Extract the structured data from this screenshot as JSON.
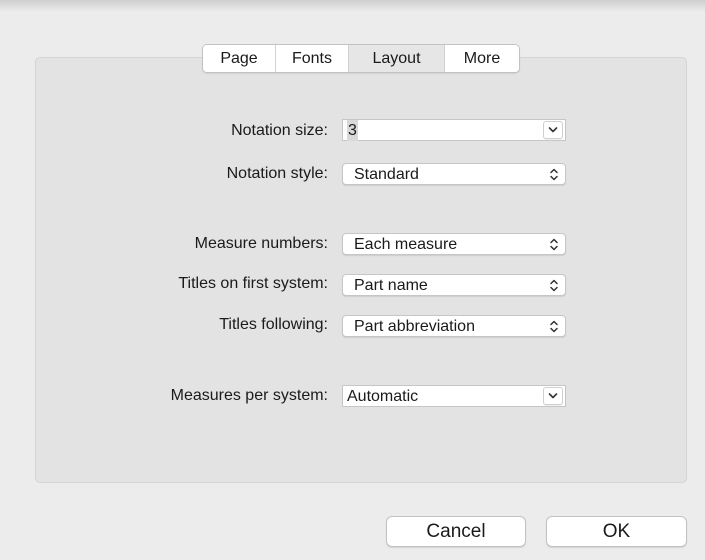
{
  "tabs": [
    {
      "label": "Page",
      "selected": false
    },
    {
      "label": "Fonts",
      "selected": false
    },
    {
      "label": "Layout",
      "selected": true
    },
    {
      "label": "More",
      "selected": false
    }
  ],
  "form": {
    "notation_size": {
      "label": "Notation size:",
      "value": "3"
    },
    "notation_style": {
      "label": "Notation style:",
      "value": "Standard"
    },
    "measure_numbers": {
      "label": "Measure numbers:",
      "value": "Each measure"
    },
    "titles_first_system": {
      "label": "Titles on first system:",
      "value": "Part name"
    },
    "titles_following": {
      "label": "Titles following:",
      "value": "Part abbreviation"
    },
    "measures_per_system": {
      "label": "Measures per system:",
      "value": "Automatic"
    }
  },
  "buttons": {
    "cancel": "Cancel",
    "ok": "OK"
  },
  "icons": {
    "combo_arrow": "chevron-down-icon",
    "popup_arrows": "up-down-arrows-icon"
  }
}
